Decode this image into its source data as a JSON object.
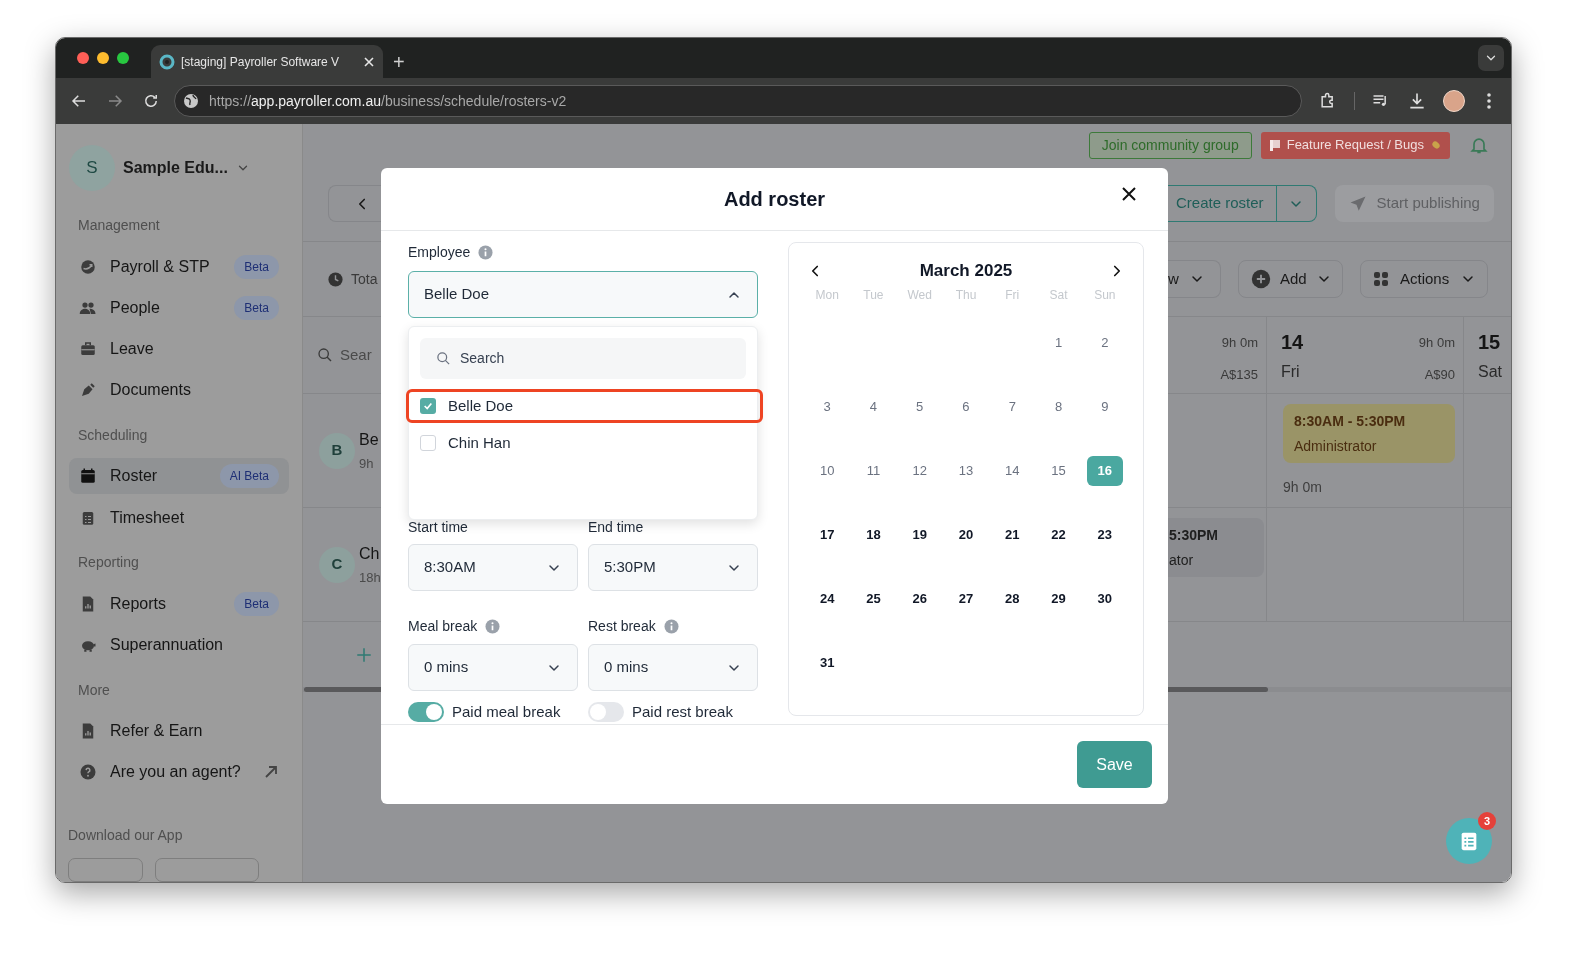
{
  "browser": {
    "tab_title": "[staging] Payroller Software V",
    "new_tab": "+",
    "url": {
      "scheme": "https://",
      "host": "app.payroller.com.au",
      "path": "/business/schedule/rosters-v2"
    }
  },
  "sidebar": {
    "org": {
      "initial": "S",
      "name": "Sample Edu..."
    },
    "sections": [
      {
        "title": "Management",
        "items": [
          {
            "label": "Payroll & STP",
            "badge": "Beta",
            "selected": false,
            "external": false
          },
          {
            "label": "People",
            "badge": "Beta",
            "selected": false,
            "external": false
          },
          {
            "label": "Leave",
            "selected": false,
            "external": false
          },
          {
            "label": "Documents",
            "selected": false,
            "external": false
          }
        ]
      },
      {
        "title": "Scheduling",
        "items": [
          {
            "label": "Roster",
            "badge": "AI Beta",
            "selected": true,
            "external": false
          },
          {
            "label": "Timesheet",
            "selected": false,
            "external": false
          }
        ]
      },
      {
        "title": "Reporting",
        "items": [
          {
            "label": "Reports",
            "badge": "Beta",
            "selected": false,
            "external": false
          },
          {
            "label": "Superannuation",
            "selected": false,
            "external": false
          }
        ]
      },
      {
        "title": "More",
        "items": [
          {
            "label": "Refer & Earn",
            "selected": false,
            "external": false
          },
          {
            "label": "Are you an agent?",
            "selected": false,
            "external": true
          }
        ]
      }
    ],
    "download_label": "Download our App"
  },
  "topbar": {
    "community": "Join community group",
    "feature": "Feature Request / Bugs"
  },
  "toolbar": {
    "create_roster": "Create roster",
    "publish": {
      "label": "Start publishing",
      "disabled": true
    },
    "total": "Tota",
    "view": "w",
    "add": "Add",
    "actions": "Actions"
  },
  "grid": {
    "search": "Sear",
    "days": [
      {
        "hours": "9h 0m",
        "cost": "A$135"
      },
      {
        "number": "14",
        "weekday": "Fri",
        "hours": "9h 0m",
        "cost": "A$90"
      },
      {
        "number": "15",
        "weekday": "Sat"
      }
    ],
    "employees": [
      {
        "initial": "B",
        "name": "Be",
        "hours": "9h",
        "cells": [
          null,
          {
            "time": "8:30AM - 5:30PM",
            "role": "Administrator",
            "total": "9h 0m",
            "color": "#9a9467"
          },
          null
        ]
      },
      {
        "initial": "C",
        "name": "Ch",
        "hours": "18h",
        "cells": [
          {
            "time": "5:30PM",
            "role": "ator",
            "color": "#8b8c90"
          },
          null,
          null
        ]
      }
    ]
  },
  "modal": {
    "title": "Add roster",
    "employee": {
      "label": "Employee",
      "value": "Belle Doe",
      "expanded": true,
      "search_placeholder": "Search",
      "options": [
        {
          "label": "Belle Doe",
          "checked": true,
          "highlighted": true
        },
        {
          "label": "Chin Han",
          "checked": false,
          "highlighted": false
        }
      ]
    },
    "fields": [
      {
        "label": "Start time",
        "value": "8:30AM",
        "info": false
      },
      {
        "label": "End time",
        "value": "5:30PM",
        "info": false
      },
      {
        "label": "Meal break",
        "value": "0 mins",
        "info": true
      },
      {
        "label": "Rest break",
        "value": "0 mins",
        "info": true
      }
    ],
    "toggles": [
      {
        "label": "Paid meal break",
        "on": true
      },
      {
        "label": "Paid rest break",
        "on": false
      }
    ],
    "calendar": {
      "month": "March 2025",
      "weekdays": [
        "Mon",
        "Tue",
        "Wed",
        "Thu",
        "Fri",
        "Sat",
        "Sun"
      ],
      "weeks": [
        [
          {
            "day": "1",
            "disabled": true,
            "selected": false
          },
          {
            "day": "2",
            "disabled": true,
            "selected": false
          }
        ],
        [
          {
            "day": "3",
            "disabled": true,
            "selected": false
          },
          {
            "day": "4",
            "disabled": true,
            "selected": false
          },
          {
            "day": "5",
            "disabled": true,
            "selected": false
          },
          {
            "day": "6",
            "disabled": true,
            "selected": false
          },
          {
            "day": "7",
            "disabled": true,
            "selected": false
          },
          {
            "day": "8",
            "disabled": true,
            "selected": false
          },
          {
            "day": "9",
            "disabled": true,
            "selected": false
          }
        ],
        [
          {
            "day": "10",
            "disabled": true,
            "selected": false
          },
          {
            "day": "11",
            "disabled": true,
            "selected": false
          },
          {
            "day": "12",
            "disabled": true,
            "selected": false
          },
          {
            "day": "13",
            "disabled": true,
            "selected": false
          },
          {
            "day": "14",
            "disabled": true,
            "selected": false
          },
          {
            "day": "15",
            "disabled": true,
            "selected": false
          },
          {
            "day": "16",
            "disabled": false,
            "selected": true
          }
        ],
        [
          {
            "day": "17",
            "disabled": false,
            "selected": false
          },
          {
            "day": "18",
            "disabled": false,
            "selected": false
          },
          {
            "day": "19",
            "disabled": false,
            "selected": false
          },
          {
            "day": "20",
            "disabled": false,
            "selected": false
          },
          {
            "day": "21",
            "disabled": false,
            "selected": false
          },
          {
            "day": "22",
            "disabled": false,
            "selected": false
          },
          {
            "day": "23",
            "disabled": false,
            "selected": false
          }
        ],
        [
          {
            "day": "24",
            "disabled": false,
            "selected": false
          },
          {
            "day": "25",
            "disabled": false,
            "selected": false
          },
          {
            "day": "26",
            "disabled": false,
            "selected": false
          },
          {
            "day": "27",
            "disabled": false,
            "selected": false
          },
          {
            "day": "28",
            "disabled": false,
            "selected": false
          },
          {
            "day": "29",
            "disabled": false,
            "selected": false
          },
          {
            "day": "30",
            "disabled": false,
            "selected": false
          }
        ],
        [
          {
            "day": "31",
            "disabled": false,
            "selected": false
          }
        ]
      ]
    },
    "save": "Save"
  },
  "chat_widget": {
    "badge": "3"
  }
}
